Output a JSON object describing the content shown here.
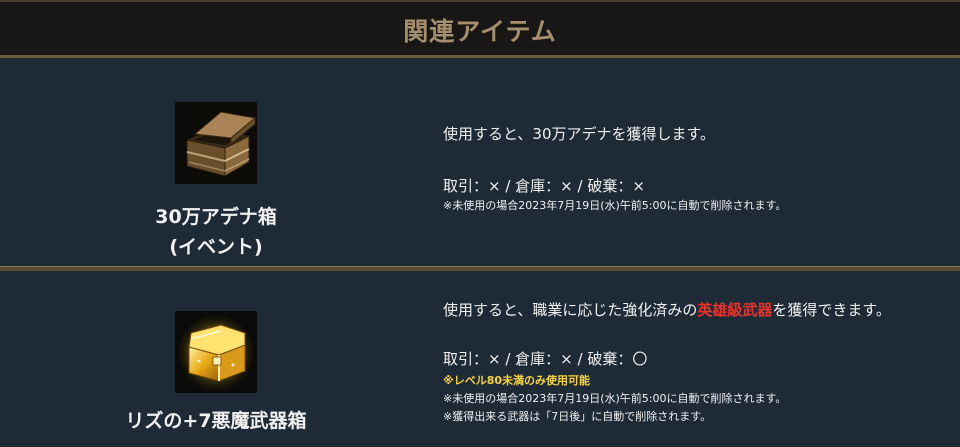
{
  "header": {
    "title": "関連アイテム"
  },
  "items": [
    {
      "icon": "wooden-chest-icon",
      "name_line1": "30万アデナ箱",
      "name_line2": "(イベント)",
      "description": "使用すると、30万アデナを獲得します。",
      "trade": "取引：× / 倉庫：× / 破棄：×",
      "notes": [
        "※未使用の場合2023年7月19日(水)午前5:00に自動で削除されます。"
      ]
    },
    {
      "icon": "golden-chest-icon",
      "name_line1": "リズの+7悪魔武器箱",
      "description_pre": "使用すると、職業に応じた強化済みの",
      "description_highlight": "英雄級武器",
      "description_post": "を獲得できます。",
      "highlight_color": "#e8332a",
      "trade": "取引：× / 倉庫：× / 破棄：〇",
      "notice_yellow": "※レベル80未満のみ使用可能",
      "notes": [
        "※未使用の場合2023年7月19日(水)午前5:00に自動で削除されます。",
        "※獲得出来る武器は「7日後」に自動で削除されます。"
      ]
    }
  ]
}
